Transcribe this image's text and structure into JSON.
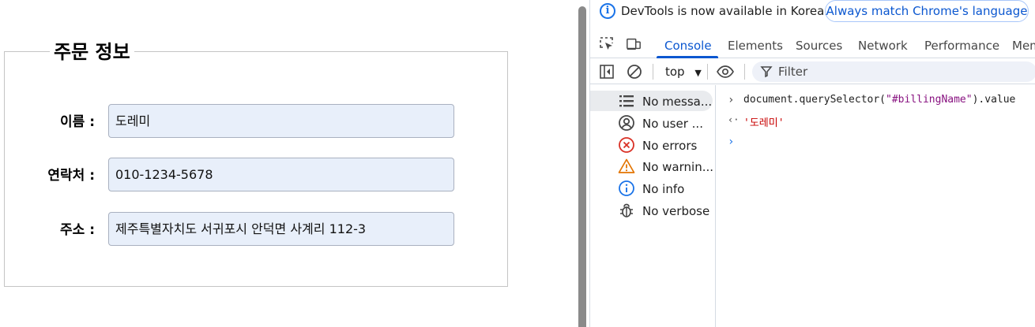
{
  "form": {
    "legend": "주문 정보",
    "fields": [
      {
        "label": "이름 :",
        "value": "도레미"
      },
      {
        "label": "연락처 :",
        "value": "010-1234-5678"
      },
      {
        "label": "주소 :",
        "value": "제주특별자치도 서귀포시 안덕면 사계리 112-3"
      }
    ]
  },
  "devtools": {
    "infobar": {
      "message": "DevTools is now available in Korean!",
      "button": "Always match Chrome's language"
    },
    "tabs": [
      "Console",
      "Elements",
      "Sources",
      "Network",
      "Performance",
      "Mem"
    ],
    "active_tab": "Console",
    "toolbar": {
      "context": "top",
      "filter_placeholder": "Filter"
    },
    "sidebar": [
      {
        "icon": "list-icon",
        "label": "No messa..."
      },
      {
        "icon": "user-icon",
        "label": "No user ..."
      },
      {
        "icon": "error-icon",
        "label": "No errors"
      },
      {
        "icon": "warning-icon",
        "label": "No warnin..."
      },
      {
        "icon": "info-icon",
        "label": "No info"
      },
      {
        "icon": "bug-icon",
        "label": "No verbose"
      }
    ],
    "console": {
      "input_prefix": "document.querySelector(",
      "input_selector": "\"#billingName\"",
      "input_suffix": ").value",
      "output": "'도레미'"
    }
  },
  "colors": {
    "accent": "#0b57d0",
    "error": "#d93025",
    "warning": "#e37400",
    "info": "#1a73e8",
    "input_bg": "#e8effa"
  }
}
